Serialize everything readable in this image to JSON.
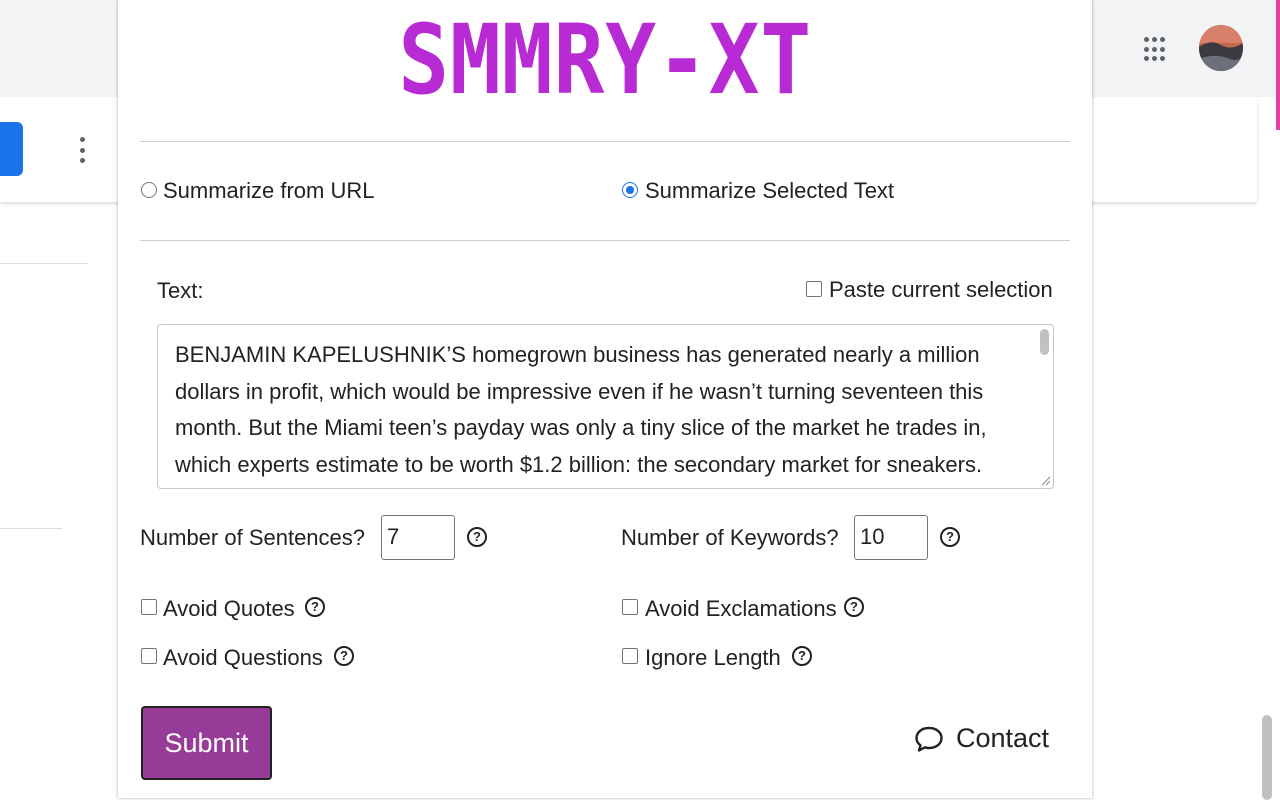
{
  "popup": {
    "logo": "SMMRY-XT",
    "mode": {
      "url_label": "Summarize from URL",
      "selected_label": "Summarize Selected Text",
      "selected": "selected"
    },
    "text_label": "Text:",
    "paste_label": "Paste current selection",
    "text_value": "BENJAMIN KAPELUSHNIK’S homegrown business has generated nearly a million dollars in profit, which would be impressive even if he wasn’t turning seventeen this month. But the Miami teen’s payday was only a tiny slice of the market he trades in, which experts estimate to be worth $1.2 billion: the secondary market for sneakers. Sneakerheads, as they’re called, spend thousands on limited-edition shoes and resell them for a profit.",
    "sentences_label": "Number of Sentences?",
    "sentences_value": "7",
    "keywords_label": "Number of Keywords?",
    "keywords_value": "10",
    "options": {
      "avoid_quotes": "Avoid Quotes",
      "avoid_exclamations": "Avoid Exclamations",
      "avoid_questions": "Avoid Questions",
      "ignore_length": "Ignore Length"
    },
    "help_glyph": "?",
    "submit_label": "Submit",
    "contact_label": "Contact"
  },
  "colors": {
    "logo": "#b82bd4",
    "submit": "#963c98",
    "radio_selected": "#1a73e8",
    "background_button": "#1a73e8"
  },
  "icons": [
    "apps-grid-icon",
    "avatar",
    "more-vert-icon",
    "help-circle-icon",
    "chat-bubble-icon"
  ]
}
